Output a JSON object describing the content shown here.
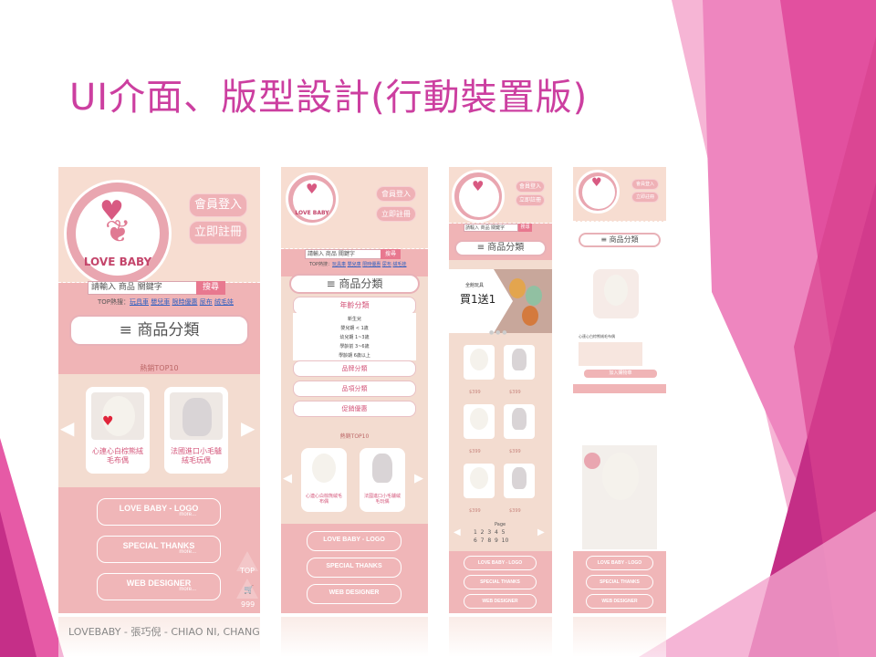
{
  "slide": {
    "title": "UI介面、版型設計(行動裝置版)",
    "caption": "LOVEBABY - 張巧倪 - CHIAO NI, CHANG"
  },
  "colors": {
    "accent": "#cc3fa0",
    "pink": "#f0b4b6",
    "cream": "#f3dcd0",
    "rose": "#e8788f"
  },
  "brand": {
    "logo_text": "LOVE BABY"
  },
  "header": {
    "login": "會員登入",
    "register": "立即註冊"
  },
  "search": {
    "placeholder": "請輸入 商品 關鍵字",
    "button": "搜尋"
  },
  "hot": {
    "label": "TOP熱搜：",
    "items": [
      "玩具車",
      "嬰兒車",
      "限時優惠",
      "尿布",
      "絨毛娃"
    ]
  },
  "category": {
    "label": "≡ 商品分類",
    "menu": [
      "年齡分類",
      "品牌分類",
      "品項分類",
      "促銷優惠"
    ],
    "ages": [
      "新生兒",
      "嬰兒期 < 1歲",
      "幼兒期 1~3歲",
      "學齡前 3~6歲",
      "學齡期 6歲以上"
    ]
  },
  "top10": {
    "label": "熱銷TOP10",
    "products": [
      "心連心白棕熊絨毛布偶",
      "法國進口小毛驢絨毛玩偶"
    ]
  },
  "footer": {
    "buttons": [
      "LOVE BABY - LOGO",
      "SPECIAL THANKS",
      "WEB DESIGNER"
    ],
    "more": "more..."
  },
  "widgets": {
    "top": "TOP",
    "cart_count": "999"
  },
  "promo": {
    "line1": "全館玩具",
    "line2": "買1送1"
  },
  "list": {
    "price": "$399",
    "page_label": "Page",
    "pages": [
      "1",
      "2",
      "3",
      "4",
      "5",
      "6",
      "7",
      "8",
      "9",
      "10"
    ]
  },
  "detail": {
    "product": "心連心白棕熊絨毛布偶",
    "cart": "加入購物車"
  },
  "icons": [
    "search-icon",
    "cart-icon",
    "left-arrow-icon",
    "right-arrow-icon",
    "menu-icon"
  ]
}
